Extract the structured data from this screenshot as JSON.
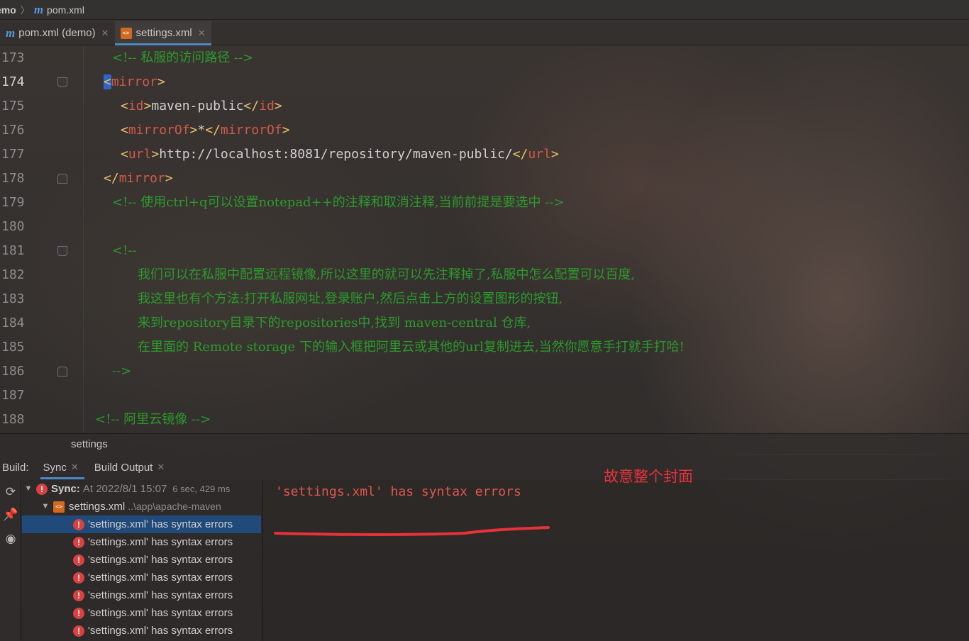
{
  "breadcrumb": {
    "project": "emo",
    "file": "pom.xml"
  },
  "tabs": [
    {
      "label": "pom.xml (demo)",
      "icon": "maven-icon"
    },
    {
      "label": "settings.xml",
      "icon": "xml-file-icon"
    }
  ],
  "editor": {
    "current_line": 174,
    "lines": [
      {
        "n": "173",
        "c1": "<!-- 私服的访问路径 -->"
      },
      {
        "n": "174",
        "c1": "<",
        "c2": "mirror",
        "c3": ">"
      },
      {
        "n": "175",
        "c1": "<",
        "c2": "id",
        "c3": ">",
        "c4": "maven-public",
        "c5": "</",
        "c6": "id",
        "c7": ">"
      },
      {
        "n": "176",
        "c1": "<",
        "c2": "mirrorOf",
        "c3": ">",
        "c4": "*",
        "c5": "</",
        "c6": "mirrorOf",
        "c7": ">"
      },
      {
        "n": "177",
        "c1": "<",
        "c2": "url",
        "c3": ">",
        "c4": "http://localhost:8081/repository/maven-public/",
        "c5": "</",
        "c6": "url",
        "c7": ">"
      },
      {
        "n": "178",
        "c1": "</",
        "c2": "mirror",
        "c3": ">"
      },
      {
        "n": "179",
        "c1": "<!-- 使用ctrl+q可以设置notepad++的注释和取消注释,当前前提是要选中 -->"
      },
      {
        "n": "180"
      },
      {
        "n": "181",
        "c1": "<!--"
      },
      {
        "n": "182",
        "c1": "我们可以在私服中配置远程镜像,所以这里的就可以先注释掉了,私服中怎么配置可以百度,"
      },
      {
        "n": "183",
        "c1": "我这里也有个方法:打开私服网址,登录账户,然后点击上方的设置图形的按钮,"
      },
      {
        "n": "184",
        "c1": "来到repository目录下的repositories中,找到 maven-central 仓库,"
      },
      {
        "n": "185",
        "c1": "在里面的 Remote storage 下的输入框把阿里云或其他的url复制进去,当然你愿意手打就手打哈!"
      },
      {
        "n": "186",
        "c1": "-->"
      },
      {
        "n": "187"
      },
      {
        "n": "188",
        "c1": "<!-- 阿里云镜像 -->"
      }
    ]
  },
  "file_breadcrumb": "settings",
  "build": {
    "title": "Build:",
    "tabs": [
      "Sync",
      "Build Output"
    ],
    "tree": {
      "sync_label": "Sync:",
      "sync_time": "At 2022/8/1 15:07",
      "sync_duration": "6 sec, 429 ms",
      "file_label": "settings.xml",
      "file_path": "..\\app\\apache-maven",
      "errors": [
        "'settings.xml' has syntax errors",
        "'settings.xml' has syntax errors",
        "'settings.xml' has syntax errors",
        "'settings.xml' has syntax errors",
        "'settings.xml' has syntax errors",
        "'settings.xml' has syntax errors",
        "'settings.xml' has syntax errors"
      ]
    },
    "output_message": "'settings.xml' has syntax errors"
  },
  "annotation": "故意整个封面",
  "colors": {
    "xml_tag_bracket": "#e8bf6a",
    "xml_tag_name": "#d15a48",
    "comment": "#2c9a2c",
    "error": "#e0574f",
    "selection": "#1f4a7a",
    "accent": "#4a88c7",
    "annotation": "#e8323a"
  }
}
